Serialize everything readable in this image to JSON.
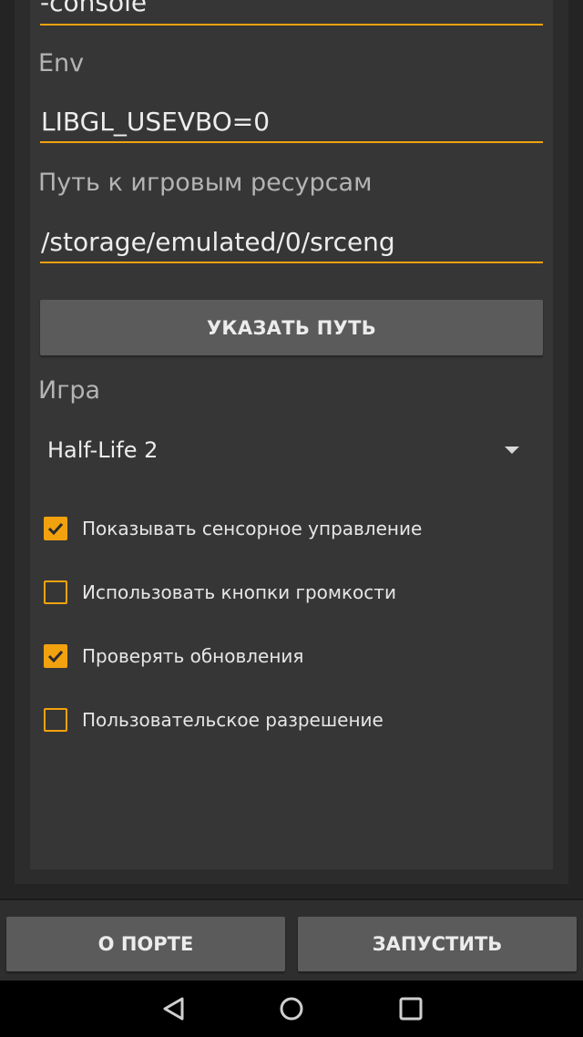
{
  "top_field": {
    "value": "-console"
  },
  "env": {
    "label": "Env",
    "value": "LIBGL_USEVBO=0"
  },
  "resources": {
    "label": "Путь к игровым ресурсам",
    "value": "/storage/emulated/0/srceng"
  },
  "path_button": {
    "label": "УКАЗАТЬ ПУТЬ"
  },
  "game": {
    "label": "Игра",
    "selected": "Half-Life 2"
  },
  "checkboxes": [
    {
      "label": "Показывать сенсорное управление",
      "checked": true
    },
    {
      "label": "Использовать кнопки громкости",
      "checked": false
    },
    {
      "label": "Проверять обновления",
      "checked": true
    },
    {
      "label": "Пользовательское разрешение",
      "checked": false
    }
  ],
  "bottom": {
    "about_label": "О ПОРТЕ",
    "launch_label": "ЗАПУСТИТЬ"
  },
  "colors": {
    "accent": "#f2a20f",
    "panel": "#363636",
    "button": "#5b5b5b"
  },
  "nav": {
    "back_icon": "back-triangle-icon",
    "home_icon": "home-circle-icon",
    "recents_icon": "recents-square-icon"
  }
}
